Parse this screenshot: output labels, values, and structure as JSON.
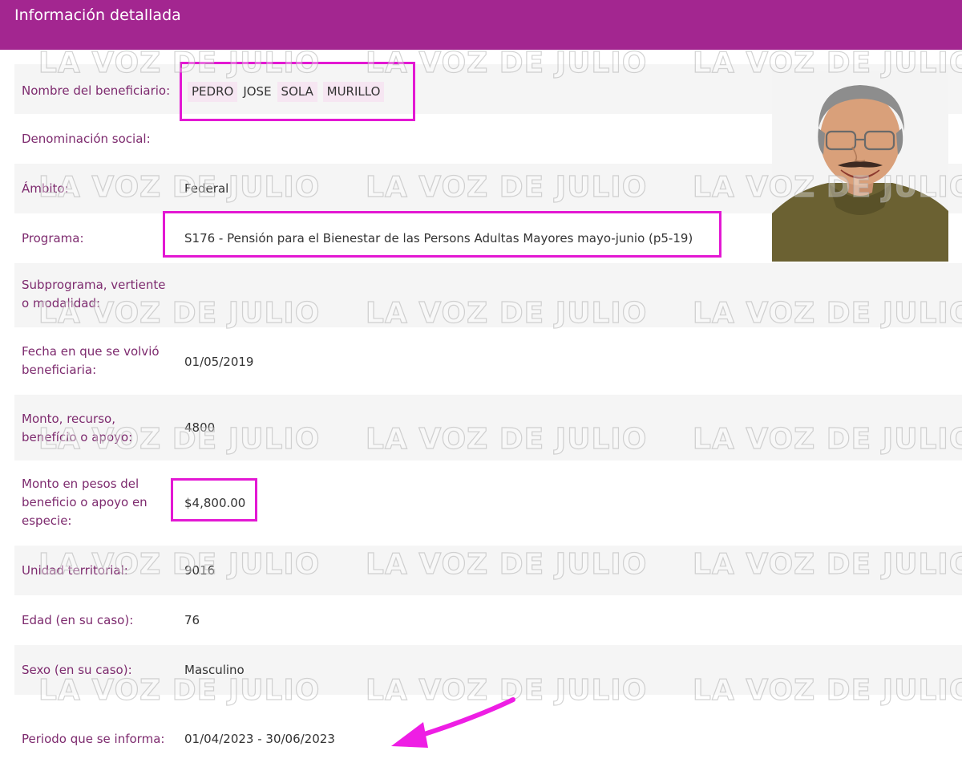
{
  "header": {
    "title": "Información detallada"
  },
  "watermark": "LA VOZ DE JULIO",
  "rows": {
    "beneficiario": {
      "label": "Nombre del beneficiario:",
      "name_parts": [
        "PEDRO",
        "JOSE",
        "SOLA",
        "MURILLO"
      ]
    },
    "denominacion": {
      "label": "Denominación social:",
      "value": ""
    },
    "ambito": {
      "label": "Ámbito:",
      "value": "Federal"
    },
    "programa": {
      "label": "Programa:",
      "value": "S176 - Pensión para el Bienestar de las Persons Adultas Mayores mayo-junio (p5-19)"
    },
    "subprograma": {
      "label_line1": "Subprograma, vertiente",
      "label_line2": "o modalidad:",
      "value": ""
    },
    "fecha": {
      "label_line1": "Fecha en que se volvió",
      "label_line2": "beneficiaria:",
      "value": "01/05/2019"
    },
    "monto": {
      "label_line1": "Monto, recurso,",
      "label_line2": "benefício o apoyo:",
      "value": "4800"
    },
    "monto_pesos": {
      "label_line1": "Monto en pesos del",
      "label_line2": "beneficio o apoyo en",
      "label_line3": "especie:",
      "value": "$4,800.00"
    },
    "unidad": {
      "label": "Unidad territorial:",
      "value": "9016"
    },
    "edad": {
      "label": "Edad (en su caso):",
      "value": "76"
    },
    "sexo": {
      "label": "Sexo (en su caso):",
      "value": "Masculino"
    },
    "periodo": {
      "label": "Periodo que se informa:",
      "value": "01/04/2023 - 30/06/2023"
    }
  },
  "colors": {
    "header": "#a32690",
    "label": "#7d2a6e",
    "highlight_frame": "#e318d3",
    "row_shade": "#f5f5f5"
  }
}
